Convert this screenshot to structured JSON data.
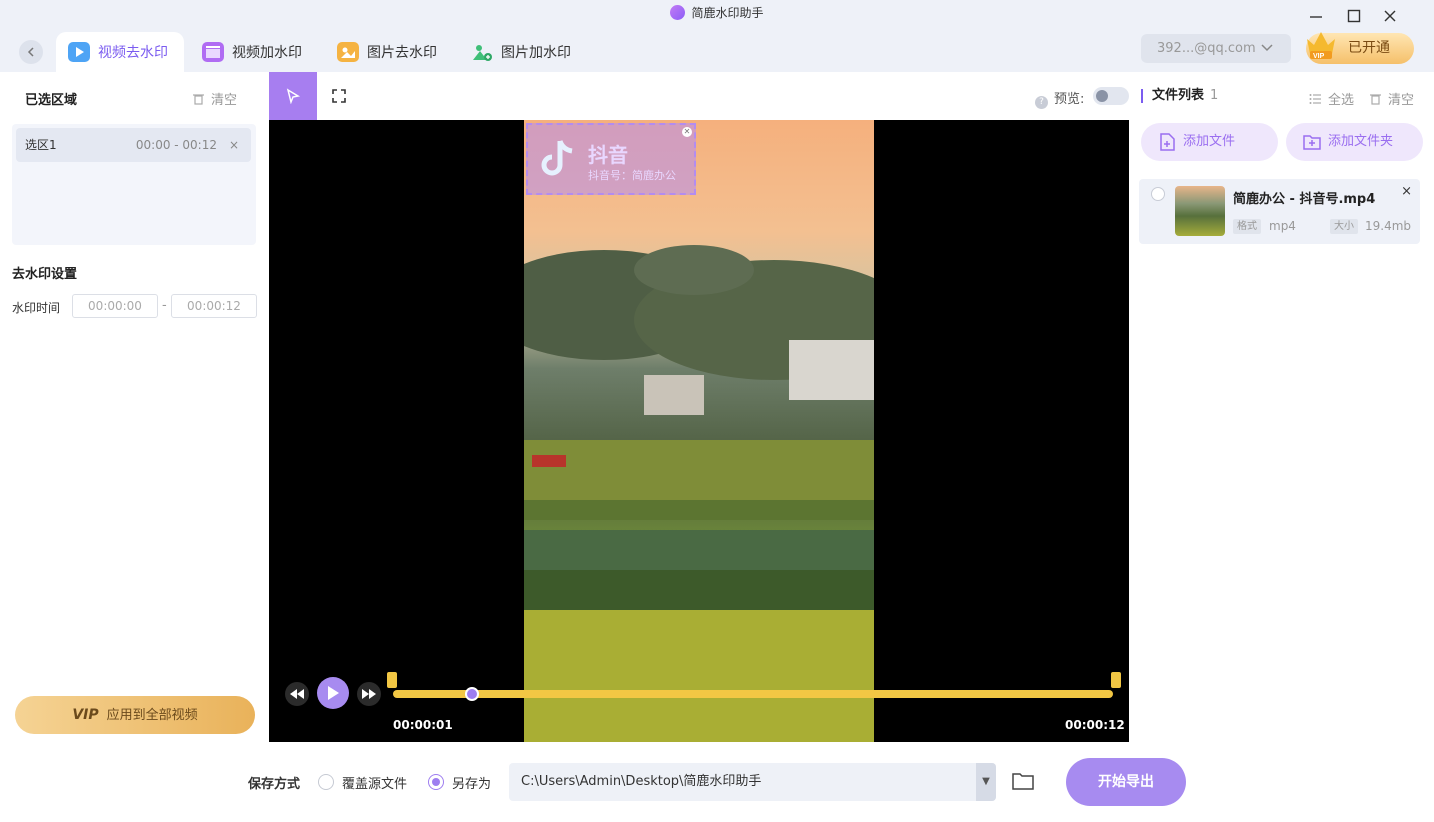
{
  "window": {
    "title": "简鹿水印助手",
    "minimize": "—",
    "maximize": "☐",
    "close": "✕"
  },
  "tabs": [
    {
      "label": "视频去水印",
      "icon": "video-erase-icon",
      "active": true
    },
    {
      "label": "视频加水印",
      "icon": "video-add-icon"
    },
    {
      "label": "图片去水印",
      "icon": "image-erase-icon"
    },
    {
      "label": "图片加水印",
      "icon": "image-add-icon"
    }
  ],
  "account": {
    "email": "392...@qq.com",
    "vip_label": "已开通",
    "vip_badge": "VIP"
  },
  "left": {
    "selected_title": "已选区域",
    "clear": "清空",
    "regions": [
      {
        "name": "选区1",
        "time": "00:00 - 00:12",
        "close": "×"
      }
    ],
    "settings_title": "去水印设置",
    "time_label": "水印时间",
    "start_placeholder": "00:00:00",
    "end_placeholder": "00:00:12",
    "dash": "-",
    "apply_vip": "VIP",
    "apply_label": "应用到全部视频"
  },
  "toolbar": {
    "preview_label": "预览:",
    "preview_on": false
  },
  "player": {
    "current_time": "00:00:01",
    "end_time": "00:00:12",
    "progress": 0.11,
    "watermark_text": "抖音",
    "watermark_sub": "抖音号：简鹿办公"
  },
  "right": {
    "title": "文件列表",
    "count": "1",
    "select_all": "全选",
    "clear": "清空",
    "add_file": "添加文件",
    "add_folder": "添加文件夹",
    "files": [
      {
        "name": "简鹿办公 - 抖音号.mp4",
        "format_tag": "格式",
        "format": "mp4",
        "size_tag": "大小",
        "size": "19.4mb",
        "close": "×"
      }
    ]
  },
  "bottom": {
    "save_label": "保存方式",
    "option_overwrite": "覆盖源文件",
    "option_saveas": "另存为",
    "selected_option": "saveas",
    "path": "C:\\Users\\Admin\\Desktop\\简鹿水印助手",
    "export": "开始导出"
  },
  "colors": {
    "accent": "#9e7ef0",
    "track": "#f2c744",
    "vip_gold": "#f5c06a"
  }
}
